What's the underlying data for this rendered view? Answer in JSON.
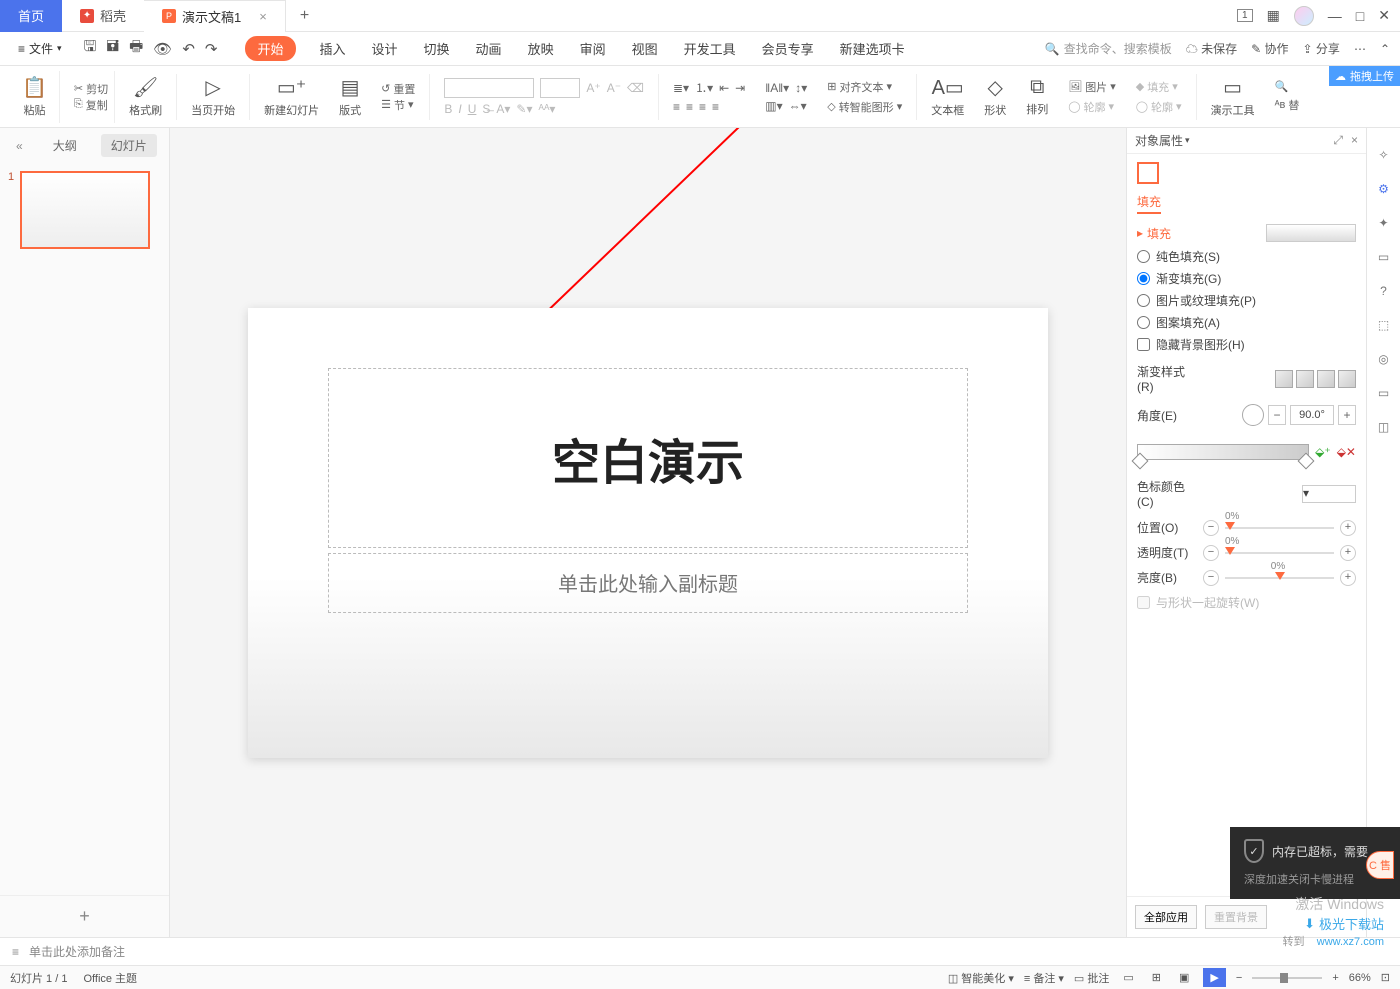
{
  "titlebar": {
    "tabs": {
      "home": "首页",
      "dk": "稻壳",
      "doc": "演示文稿1"
    },
    "add": "+",
    "win_one": "1"
  },
  "menubar": {
    "file": "文件",
    "tabs": [
      "开始",
      "插入",
      "设计",
      "切换",
      "动画",
      "放映",
      "审阅",
      "视图",
      "开发工具",
      "会员专享",
      "新建选项卡"
    ],
    "search": "查找命令、搜索模板",
    "unsaved": "未保存",
    "coop": "协作",
    "share": "分享"
  },
  "ribbon": {
    "paste": "粘贴",
    "cut": "剪切",
    "copy": "复制",
    "format_painter": "格式刷",
    "from_current": "当页开始",
    "new_slide": "新建幻灯片",
    "layout": "版式",
    "reset": "重置",
    "section": "节",
    "align_text": "对齐文本",
    "convert_smart": "转智能图形",
    "textbox": "文本框",
    "shape": "形状",
    "arrange": "排列",
    "picture": "图片",
    "fill": "填充",
    "outline": "轮廓",
    "present_tools": "演示工具",
    "replace": "替",
    "cloud_drag": "拖拽上传"
  },
  "side": {
    "outline": "大纲",
    "slides": "幻灯片",
    "num": "1",
    "add": "+"
  },
  "slide": {
    "title": "空白演示",
    "subtitle": "单击此处输入副标题"
  },
  "notes": {
    "placeholder": "单击此处添加备注"
  },
  "panel": {
    "header": "对象属性",
    "fill_tab": "填充",
    "section": "填充",
    "solid": "纯色填充(S)",
    "gradient": "渐变填充(G)",
    "picture": "图片或纹理填充(P)",
    "pattern": "图案填充(A)",
    "hide_bg": "隐藏背景图形(H)",
    "grad_style": "渐变样式(R)",
    "angle": "角度(E)",
    "angle_val": "90.0°",
    "stop_color": "色标颜色(C)",
    "position": "位置(O)",
    "transparency": "透明度(T)",
    "brightness": "亮度(B)",
    "pct": "0%",
    "rotate_with": "与形状一起旋转(W)",
    "apply_all": "全部应用",
    "reset_bg": "重置背景"
  },
  "status": {
    "slide_count": "幻灯片 1 / 1",
    "theme": "Office 主题",
    "beautify": "智能美化",
    "notes_btn": "备注",
    "comments": "批注",
    "zoom": "66%"
  },
  "popup": {
    "title": "内存已超标，需要",
    "sub": "深度加速关闭卡慢进程"
  },
  "watermark": {
    "win": "激活 Windows",
    "go": "转到",
    "xz": "极光下载站",
    "url": "www.xz7.com"
  },
  "cc": "C 售"
}
